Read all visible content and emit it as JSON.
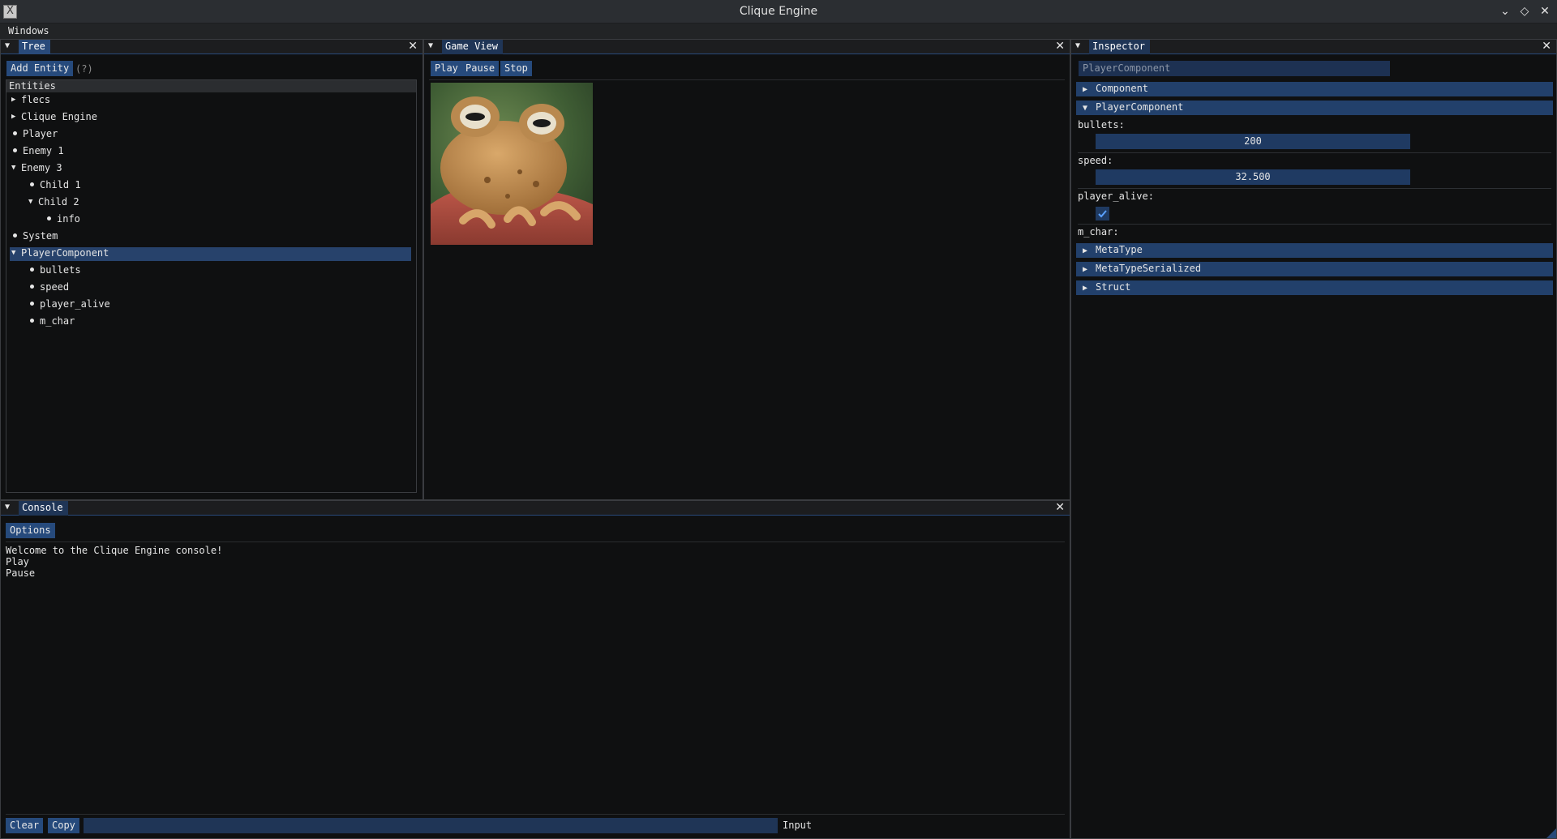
{
  "window": {
    "title": "Clique Engine"
  },
  "menubar": {
    "items": [
      "Windows"
    ]
  },
  "tree": {
    "tab": "Tree",
    "add_button": "Add Entity",
    "help": "(?)",
    "header": "Entities",
    "rows": [
      {
        "label": "flecs",
        "kind": "collapsed",
        "depth": 0
      },
      {
        "label": "Clique Engine",
        "kind": "collapsed",
        "depth": 0
      },
      {
        "label": "Player",
        "kind": "leaf",
        "depth": 0
      },
      {
        "label": "Enemy 1",
        "kind": "leaf",
        "depth": 0
      },
      {
        "label": "Enemy 3",
        "kind": "expanded",
        "depth": 0
      },
      {
        "label": "Child 1",
        "kind": "leaf",
        "depth": 1
      },
      {
        "label": "Child 2",
        "kind": "expanded",
        "depth": 1
      },
      {
        "label": "info",
        "kind": "leaf",
        "depth": 2
      },
      {
        "label": "System",
        "kind": "leaf",
        "depth": 0
      },
      {
        "label": "PlayerComponent",
        "kind": "expanded",
        "depth": 0,
        "selected": true
      },
      {
        "label": "bullets",
        "kind": "leaf",
        "depth": 1
      },
      {
        "label": "speed",
        "kind": "leaf",
        "depth": 1
      },
      {
        "label": "player_alive",
        "kind": "leaf",
        "depth": 1
      },
      {
        "label": "m_char",
        "kind": "leaf",
        "depth": 1
      }
    ]
  },
  "game_view": {
    "tab": "Game View",
    "buttons": {
      "play": "Play",
      "pause": "Pause",
      "stop": "Stop"
    }
  },
  "inspector": {
    "tab": "Inspector",
    "search_value": "PlayerComponent",
    "sections": {
      "component": "Component",
      "player_component": "PlayerComponent",
      "meta_type": "MetaType",
      "meta_type_serialized": "MetaTypeSerialized",
      "struct": "Struct"
    },
    "fields": {
      "bullets_label": "bullets:",
      "bullets_value": "200",
      "speed_label": "speed:",
      "speed_value": "32.500",
      "player_alive_label": "player_alive:",
      "player_alive_checked": true,
      "m_char_label": "m_char:"
    }
  },
  "console": {
    "tab": "Console",
    "options_button": "Options",
    "lines": [
      "Welcome to the Clique Engine console!",
      "Play",
      "Pause"
    ],
    "clear_button": "Clear",
    "copy_button": "Copy",
    "input_value": "",
    "input_label": "Input"
  },
  "colors": {
    "accent": "#294a7a",
    "background": "#0f1011",
    "selected_row": "#27426b"
  },
  "icons": {
    "close": "close-icon",
    "collapse": "collapse-arrow-icon",
    "app": "x11-app-icon"
  }
}
